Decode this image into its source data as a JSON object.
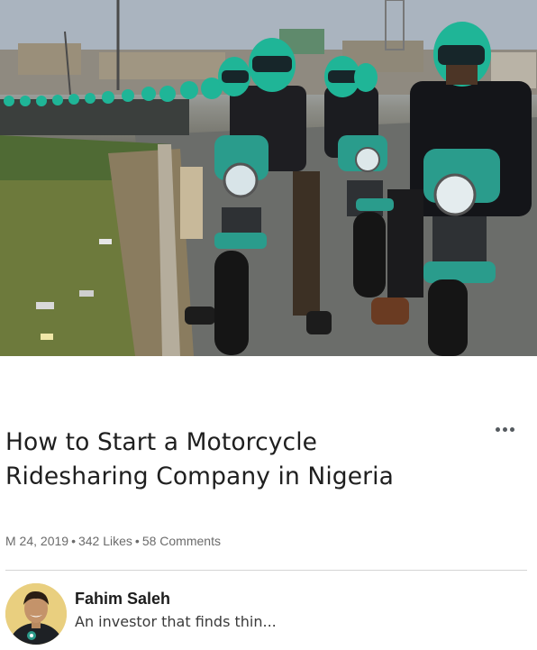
{
  "article": {
    "hero_image": "motorcycle-riders-green-helmets-photo",
    "title_line1": "How to Start a Motorcycle",
    "title_line2": "Ridesharing Company in Nigeria",
    "more_icon": "more-horizontal-icon",
    "meta": {
      "date": "M 24, 2019",
      "likes": "342 Likes",
      "comments": "58 Comments",
      "separator": "•"
    }
  },
  "author": {
    "name": "Fahim Saleh",
    "tagline": "An investor that finds thin...",
    "avatar": "avatar-photo"
  },
  "colors": {
    "helmet_green": "#1fb597",
    "title_text": "#1f1f1f",
    "meta_text": "#6b6b6b",
    "divider": "#d4d4d4"
  }
}
